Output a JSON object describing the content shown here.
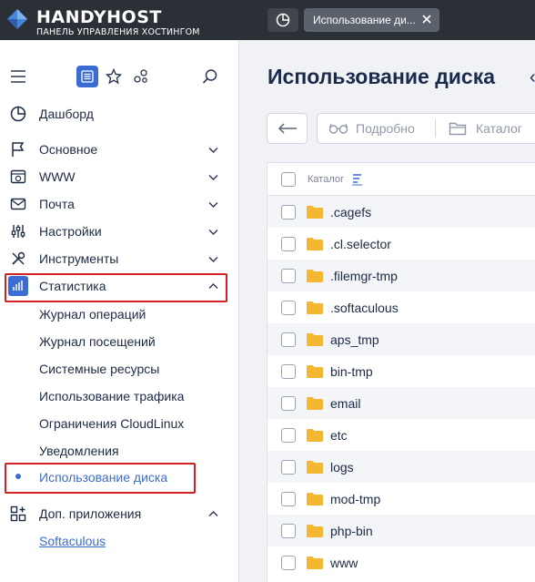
{
  "brand": {
    "name": "HANDYHOST",
    "subtitle": "ПАНЕЛЬ УПРАВЛЕНИЯ ХОСТИНГОМ"
  },
  "tabs": [
    {
      "label": "Использование ди...",
      "active": true
    }
  ],
  "sidebar": {
    "toolbar_icons": [
      "menu-icon",
      "list-view-icon",
      "star-icon",
      "apps-icon",
      "search-icon"
    ],
    "dashboard": {
      "label": "Дашборд",
      "icon": "dashboard-icon"
    },
    "sections": [
      {
        "label": "Основное",
        "icon": "flag-icon",
        "expanded": false
      },
      {
        "label": "WWW",
        "icon": "www-icon",
        "expanded": false
      },
      {
        "label": "Почта",
        "icon": "mail-icon",
        "expanded": false
      },
      {
        "label": "Настройки",
        "icon": "sliders-icon",
        "expanded": false
      },
      {
        "label": "Инструменты",
        "icon": "tools-icon",
        "expanded": false
      },
      {
        "label": "Статистика",
        "icon": "stats-icon",
        "expanded": true
      }
    ],
    "stats_items": [
      {
        "label": "Журнал операций"
      },
      {
        "label": "Журнал посещений"
      },
      {
        "label": "Системные ресурсы"
      },
      {
        "label": "Использование трафика"
      },
      {
        "label": "Ограничения CloudLinux"
      },
      {
        "label": "Уведомления"
      },
      {
        "label": "Использование диска",
        "active": true
      }
    ],
    "extra": {
      "label": "Доп. приложения",
      "icon": "apps-grid-icon",
      "expanded": true
    },
    "extra_items": [
      {
        "label": "Softaculous"
      }
    ]
  },
  "main": {
    "title": "Использование диска",
    "toolbar": {
      "back_icon": "arrow-left-icon",
      "details_label": "Подробно",
      "details_icon": "glasses-icon",
      "catalog_label": "Каталог",
      "catalog_icon": "folder-outline-icon"
    },
    "table": {
      "column": "Каталог",
      "rows": [
        ".cagefs",
        ".cl.selector",
        ".filemgr-tmp",
        ".softaculous",
        "aps_tmp",
        "bin-tmp",
        "email",
        "etc",
        "logs",
        "mod-tmp",
        "php-bin",
        "www"
      ]
    }
  },
  "colors": {
    "accent": "#3b6cd4",
    "topbar": "#2b2f36",
    "highlight": "#d32020",
    "folder": "#f5b731"
  }
}
